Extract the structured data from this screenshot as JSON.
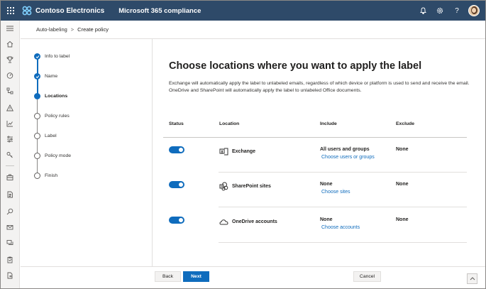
{
  "topbar": {
    "brand": "Contoso Electronics",
    "app": "Microsoft 365 compliance",
    "icons": [
      "waffle-icon",
      "bell-icon",
      "gear-icon",
      "help-icon",
      "avatar"
    ],
    "help_glyph": "?"
  },
  "breadcrumb": {
    "parent": "Auto-labeling",
    "separator": ">",
    "current": "Create policy"
  },
  "steps": [
    {
      "label": "Info to label",
      "state": "done"
    },
    {
      "label": "Name",
      "state": "done"
    },
    {
      "label": "Locations",
      "state": "current"
    },
    {
      "label": "Policy rules",
      "state": "todo"
    },
    {
      "label": "Label",
      "state": "todo"
    },
    {
      "label": "Policy mode",
      "state": "todo"
    },
    {
      "label": "Finish",
      "state": "todo"
    }
  ],
  "main": {
    "title": "Choose locations where you want to apply the label",
    "description": "Exchange will automatically apply the label to unlabeled emails, regardless of which device or platform is used to send and receive the email. OneDrive and SharePoint will automatically apply the label to unlabeled Office documents.",
    "columns": {
      "status": "Status",
      "location": "Location",
      "include": "Include",
      "exclude": "Exclude"
    },
    "rows": [
      {
        "status": "on",
        "location": "Exchange",
        "icon": "exchange-icon",
        "include": "All users and groups",
        "include_link": "Choose users or groups",
        "exclude": "None"
      },
      {
        "status": "on",
        "location": "SharePoint sites",
        "icon": "sharepoint-icon",
        "include": "None",
        "include_link": "Choose sites",
        "exclude": "None"
      },
      {
        "status": "on",
        "location": "OneDrive accounts",
        "icon": "onedrive-icon",
        "include": "None",
        "include_link": "Choose accounts",
        "exclude": "None"
      }
    ]
  },
  "footer": {
    "back": "Back",
    "next": "Next",
    "cancel": "Cancel"
  },
  "colors": {
    "topbar": "#2e4a69",
    "accent": "#0f6cbd"
  }
}
